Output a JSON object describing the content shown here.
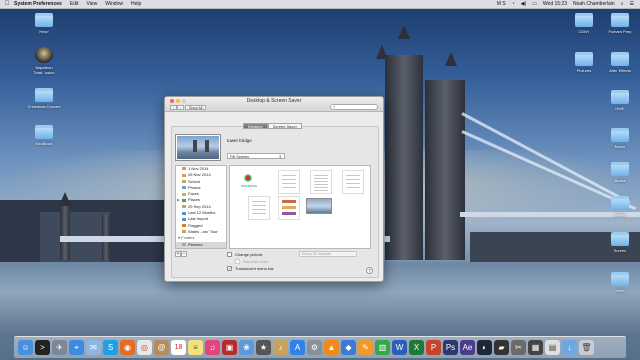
{
  "menubar": {
    "apple_icon": "apple-icon",
    "app_name": "System Preferences",
    "menus": [
      "Edit",
      "View",
      "Window",
      "Help"
    ],
    "status": {
      "clock": "Wed 15:23",
      "user": "Noah Chamberlain",
      "input_label": "M S"
    }
  },
  "desktop_left": [
    {
      "label": "Help!",
      "kind": "folder"
    },
    {
      "label": "Napoleon Total...ssion",
      "kind": "app"
    },
    {
      "label": "Christmas Concert",
      "kind": "folder"
    },
    {
      "label": "MiniBlock",
      "kind": "folder"
    }
  ],
  "desktop_right": [
    {
      "label": "OZNY",
      "kind": "folder"
    },
    {
      "label": "Fulham Prep",
      "kind": "folder"
    },
    {
      "label": "Pictures",
      "kind": "folder"
    },
    {
      "label": "After Effects",
      "kind": "folder"
    },
    {
      "label": "HWE",
      "kind": "folder"
    },
    {
      "label": "Movie",
      "kind": "folder"
    },
    {
      "label": "Books",
      "kind": "folder"
    },
    {
      "label": "Movie",
      "kind": "folder"
    },
    {
      "label": "Screen",
      "kind": "folder"
    },
    {
      "label": "iWeb",
      "kind": "folder"
    }
  ],
  "window": {
    "title": "Desktop & Screen Saver",
    "show_all": "Show All",
    "search_placeholder": "",
    "tabs": [
      {
        "label": "Desktop",
        "active": true
      },
      {
        "label": "Screen Saver",
        "active": false
      }
    ],
    "image_name": "tower bridge",
    "fill_option": "Fill Screen",
    "sources": [
      {
        "label": "1 Nov 2014",
        "type": "event",
        "selected": false
      },
      {
        "label": "25 Nov 2014",
        "type": "event",
        "selected": false
      },
      {
        "label": "School",
        "type": "event",
        "selected": false
      },
      {
        "label": "Photos",
        "type": "album",
        "selected": false
      },
      {
        "label": "Faces",
        "type": "album",
        "selected": false
      },
      {
        "label": "Places",
        "type": "album",
        "selected": false
      },
      {
        "label": "29 Sep 2014",
        "type": "event",
        "selected": false
      },
      {
        "label": "Last 12 Months",
        "type": "album",
        "selected": false
      },
      {
        "label": "Last Import",
        "type": "album",
        "selected": false
      },
      {
        "label": "Flagged",
        "type": "album",
        "selected": false
      },
      {
        "label": "Wales - arc' Tour",
        "type": "event",
        "selected": false
      },
      {
        "label": "Folders",
        "type": "header",
        "selected": false
      },
      {
        "label": "Pictures",
        "type": "folder",
        "selected": true
      }
    ],
    "thumbnail_logo_text": "WorldBuilds",
    "change_picture_label": "Change picture:",
    "change_picture_checked": false,
    "interval": "Every 30 minutes",
    "random_order_label": "Random order",
    "translucent_label": "Translucent menu bar",
    "translucent_checked": true,
    "help_label": "?",
    "add_label": "+",
    "remove_label": "−"
  },
  "dock": {
    "items": [
      "finder-icon",
      "terminal-icon",
      "launchpad-icon",
      "safari-icon",
      "mail-icon",
      "skype-icon",
      "firefox-icon",
      "chrome-icon",
      "contacts-icon",
      "calendar-icon",
      "notes-icon",
      "itunes-icon",
      "photo-booth-icon",
      "iphoto-icon",
      "imovie-icon",
      "garageband-icon",
      "app-store-icon",
      "system-preferences-icon",
      "vlc-icon",
      "keynote-icon",
      "pages-icon",
      "numbers-icon",
      "word-icon",
      "excel-icon",
      "powerpoint-icon",
      "photoshop-icon",
      "after-effects-icon",
      "steam-icon",
      "game-icon",
      "screenshot-icon",
      "activity-icon",
      "folder-stack-icon",
      "downloads-icon",
      "trash-icon"
    ],
    "calendar_day": "18"
  }
}
